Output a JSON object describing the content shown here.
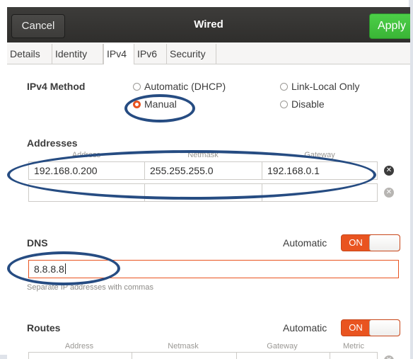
{
  "window": {
    "title": "Wired",
    "cancel_label": "Cancel",
    "apply_label": "Apply"
  },
  "tabs": [
    {
      "label": "Details",
      "active": false
    },
    {
      "label": "Identity",
      "active": false
    },
    {
      "label": "IPv4",
      "active": true
    },
    {
      "label": "IPv6",
      "active": false
    },
    {
      "label": "Security",
      "active": false
    }
  ],
  "ipv4_method": {
    "label": "IPv4 Method",
    "options": [
      {
        "label": "Automatic (DHCP)",
        "selected": false
      },
      {
        "label": "Link-Local Only",
        "selected": false
      },
      {
        "label": "Manual",
        "selected": true
      },
      {
        "label": "Disable",
        "selected": false
      }
    ]
  },
  "addresses": {
    "label": "Addresses",
    "columns": [
      "Address",
      "Netmask",
      "Gateway"
    ],
    "rows": [
      {
        "address": "192.168.0.200",
        "netmask": "255.255.255.0",
        "gateway": "192.168.0.1"
      },
      {
        "address": "",
        "netmask": "",
        "gateway": ""
      }
    ]
  },
  "dns": {
    "label": "DNS",
    "automatic_label": "Automatic",
    "switch_state": "ON",
    "value": "8.8.8.8",
    "hint": "Separate IP addresses with commas"
  },
  "routes": {
    "label": "Routes",
    "automatic_label": "Automatic",
    "switch_state": "ON",
    "columns": [
      "Address",
      "Netmask",
      "Gateway",
      "Metric"
    ]
  },
  "colors": {
    "accent": "#e95420",
    "apply_green": "#3ab536",
    "highlight_ring": "#264c82",
    "titlebar": "#353432"
  },
  "icons": {
    "clear_row": "clear-circle-icon"
  }
}
